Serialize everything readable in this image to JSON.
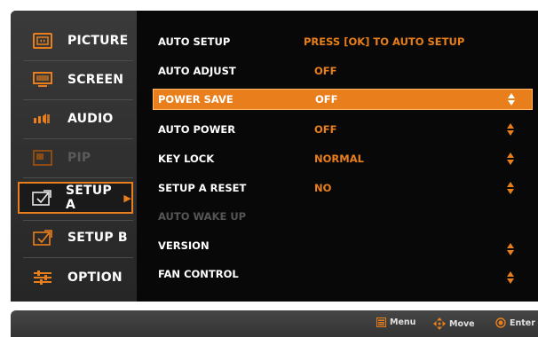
{
  "colors": {
    "accent": "#e87f1c",
    "panel": "#080808",
    "sidebar": "#2e2e2e",
    "footer": "#3c3c3c"
  },
  "sidebar": {
    "items": [
      {
        "label": "PICTURE",
        "icon": "picture-icon",
        "state": "normal"
      },
      {
        "label": "SCREEN",
        "icon": "screen-icon",
        "state": "normal"
      },
      {
        "label": "AUDIO",
        "icon": "audio-icon",
        "state": "normal"
      },
      {
        "label": "PIP",
        "icon": "pip-icon",
        "state": "disabled"
      },
      {
        "label": "SETUP A",
        "icon": "setup-a-icon",
        "state": "active",
        "arrow": "▶"
      },
      {
        "label": "SETUP B",
        "icon": "setup-b-icon",
        "state": "normal"
      },
      {
        "label": "OPTION",
        "icon": "option-icon",
        "state": "normal"
      }
    ]
  },
  "menu": {
    "rows": [
      {
        "label": "AUTO SETUP",
        "value": "PRESS [OK] TO AUTO SETUP",
        "adjustable": false,
        "selected": false,
        "disabled": false
      },
      {
        "label": "AUTO ADJUST",
        "value": "OFF",
        "adjustable": false,
        "selected": false,
        "disabled": false
      },
      {
        "label": "POWER SAVE",
        "value": "OFF",
        "adjustable": true,
        "selected": true,
        "disabled": false
      },
      {
        "label": "AUTO POWER",
        "value": "OFF",
        "adjustable": true,
        "selected": false,
        "disabled": false
      },
      {
        "label": "KEY LOCK",
        "value": "NORMAL",
        "adjustable": true,
        "selected": false,
        "disabled": false
      },
      {
        "label": "SETUP A RESET",
        "value": "NO",
        "adjustable": true,
        "selected": false,
        "disabled": false
      },
      {
        "label": "AUTO WAKE UP",
        "value": "",
        "adjustable": false,
        "selected": false,
        "disabled": true
      },
      {
        "label": "VERSION",
        "value": "",
        "adjustable": true,
        "selected": false,
        "disabled": false
      },
      {
        "label": "FAN CONTROL",
        "value": "",
        "adjustable": true,
        "selected": false,
        "disabled": false
      }
    ]
  },
  "footer": {
    "menu": {
      "label": "Menu",
      "icon": "menu-icon"
    },
    "move": {
      "label": "Move",
      "icon": "move-icon"
    },
    "enter": {
      "label": "Enter",
      "icon": "enter-icon"
    }
  }
}
